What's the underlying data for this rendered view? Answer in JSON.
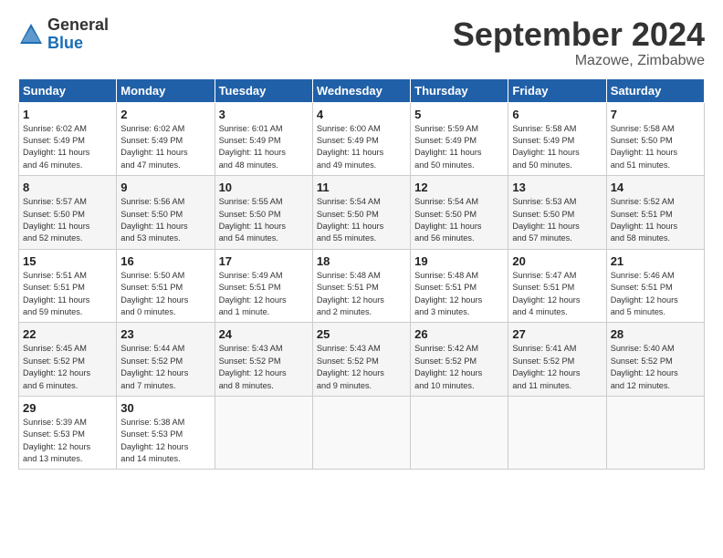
{
  "logo": {
    "general": "General",
    "blue": "Blue"
  },
  "title": "September 2024",
  "location": "Mazowe, Zimbabwe",
  "days_header": [
    "Sunday",
    "Monday",
    "Tuesday",
    "Wednesday",
    "Thursday",
    "Friday",
    "Saturday"
  ],
  "weeks": [
    [
      {
        "day": "1",
        "info": "Sunrise: 6:02 AM\nSunset: 5:49 PM\nDaylight: 11 hours\nand 46 minutes."
      },
      {
        "day": "2",
        "info": "Sunrise: 6:02 AM\nSunset: 5:49 PM\nDaylight: 11 hours\nand 47 minutes."
      },
      {
        "day": "3",
        "info": "Sunrise: 6:01 AM\nSunset: 5:49 PM\nDaylight: 11 hours\nand 48 minutes."
      },
      {
        "day": "4",
        "info": "Sunrise: 6:00 AM\nSunset: 5:49 PM\nDaylight: 11 hours\nand 49 minutes."
      },
      {
        "day": "5",
        "info": "Sunrise: 5:59 AM\nSunset: 5:49 PM\nDaylight: 11 hours\nand 50 minutes."
      },
      {
        "day": "6",
        "info": "Sunrise: 5:58 AM\nSunset: 5:49 PM\nDaylight: 11 hours\nand 50 minutes."
      },
      {
        "day": "7",
        "info": "Sunrise: 5:58 AM\nSunset: 5:50 PM\nDaylight: 11 hours\nand 51 minutes."
      }
    ],
    [
      {
        "day": "8",
        "info": "Sunrise: 5:57 AM\nSunset: 5:50 PM\nDaylight: 11 hours\nand 52 minutes."
      },
      {
        "day": "9",
        "info": "Sunrise: 5:56 AM\nSunset: 5:50 PM\nDaylight: 11 hours\nand 53 minutes."
      },
      {
        "day": "10",
        "info": "Sunrise: 5:55 AM\nSunset: 5:50 PM\nDaylight: 11 hours\nand 54 minutes."
      },
      {
        "day": "11",
        "info": "Sunrise: 5:54 AM\nSunset: 5:50 PM\nDaylight: 11 hours\nand 55 minutes."
      },
      {
        "day": "12",
        "info": "Sunrise: 5:54 AM\nSunset: 5:50 PM\nDaylight: 11 hours\nand 56 minutes."
      },
      {
        "day": "13",
        "info": "Sunrise: 5:53 AM\nSunset: 5:50 PM\nDaylight: 11 hours\nand 57 minutes."
      },
      {
        "day": "14",
        "info": "Sunrise: 5:52 AM\nSunset: 5:51 PM\nDaylight: 11 hours\nand 58 minutes."
      }
    ],
    [
      {
        "day": "15",
        "info": "Sunrise: 5:51 AM\nSunset: 5:51 PM\nDaylight: 11 hours\nand 59 minutes."
      },
      {
        "day": "16",
        "info": "Sunrise: 5:50 AM\nSunset: 5:51 PM\nDaylight: 12 hours\nand 0 minutes."
      },
      {
        "day": "17",
        "info": "Sunrise: 5:49 AM\nSunset: 5:51 PM\nDaylight: 12 hours\nand 1 minute."
      },
      {
        "day": "18",
        "info": "Sunrise: 5:48 AM\nSunset: 5:51 PM\nDaylight: 12 hours\nand 2 minutes."
      },
      {
        "day": "19",
        "info": "Sunrise: 5:48 AM\nSunset: 5:51 PM\nDaylight: 12 hours\nand 3 minutes."
      },
      {
        "day": "20",
        "info": "Sunrise: 5:47 AM\nSunset: 5:51 PM\nDaylight: 12 hours\nand 4 minutes."
      },
      {
        "day": "21",
        "info": "Sunrise: 5:46 AM\nSunset: 5:51 PM\nDaylight: 12 hours\nand 5 minutes."
      }
    ],
    [
      {
        "day": "22",
        "info": "Sunrise: 5:45 AM\nSunset: 5:52 PM\nDaylight: 12 hours\nand 6 minutes."
      },
      {
        "day": "23",
        "info": "Sunrise: 5:44 AM\nSunset: 5:52 PM\nDaylight: 12 hours\nand 7 minutes."
      },
      {
        "day": "24",
        "info": "Sunrise: 5:43 AM\nSunset: 5:52 PM\nDaylight: 12 hours\nand 8 minutes."
      },
      {
        "day": "25",
        "info": "Sunrise: 5:43 AM\nSunset: 5:52 PM\nDaylight: 12 hours\nand 9 minutes."
      },
      {
        "day": "26",
        "info": "Sunrise: 5:42 AM\nSunset: 5:52 PM\nDaylight: 12 hours\nand 10 minutes."
      },
      {
        "day": "27",
        "info": "Sunrise: 5:41 AM\nSunset: 5:52 PM\nDaylight: 12 hours\nand 11 minutes."
      },
      {
        "day": "28",
        "info": "Sunrise: 5:40 AM\nSunset: 5:52 PM\nDaylight: 12 hours\nand 12 minutes."
      }
    ],
    [
      {
        "day": "29",
        "info": "Sunrise: 5:39 AM\nSunset: 5:53 PM\nDaylight: 12 hours\nand 13 minutes."
      },
      {
        "day": "30",
        "info": "Sunrise: 5:38 AM\nSunset: 5:53 PM\nDaylight: 12 hours\nand 14 minutes."
      },
      {
        "day": "",
        "info": ""
      },
      {
        "day": "",
        "info": ""
      },
      {
        "day": "",
        "info": ""
      },
      {
        "day": "",
        "info": ""
      },
      {
        "day": "",
        "info": ""
      }
    ]
  ]
}
